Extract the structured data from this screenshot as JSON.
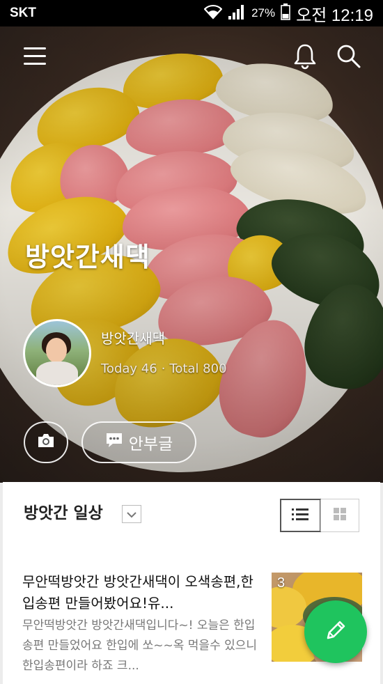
{
  "status_bar": {
    "carrier": "SKT",
    "battery_percent": "27%",
    "time": "오전 12:19"
  },
  "header": {
    "menu_icon": "hamburger-icon",
    "bell_icon": "bell-icon",
    "search_icon": "search-icon"
  },
  "profile": {
    "blog_title": "방앗간새댁",
    "nickname": "방앗간새댁",
    "today_label": "Today 46",
    "separator": "·",
    "total_label": "Total 800",
    "camera_icon": "camera-icon",
    "notice_icon": "speech-bubble-icon",
    "notice_label": "안부글"
  },
  "category": {
    "title": "방앗간 일상",
    "dropdown_icon": "chevron-down-icon",
    "list_view_icon": "list-view-icon",
    "grid_view_icon": "grid-view-icon"
  },
  "post": {
    "title": "무안떡방앗간 방앗간새댁이 오색송편,한입송편 만들어봤어요!유...",
    "excerpt": "무안떡방앗간 방앗간새댁입니다~! 오늘은 한입송편 만들었어요 한입에 쏘~~옥 먹을수 있으니 한입송편이라 하죠 크...",
    "image_count": "3"
  },
  "fab": {
    "icon": "pencil-icon"
  },
  "colors": {
    "fab_green": "#1fc45e",
    "status_bar": "#000000"
  }
}
